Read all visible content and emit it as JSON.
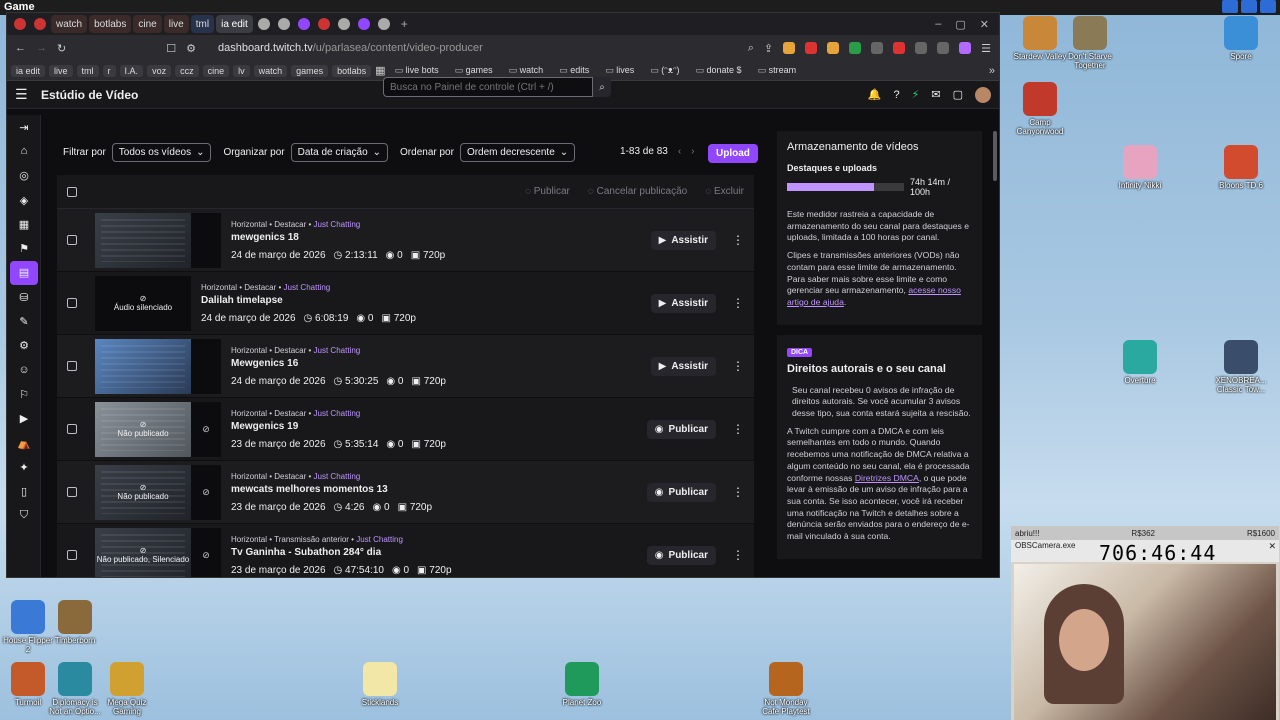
{
  "os": {
    "title": "Game"
  },
  "tabs": [
    {
      "label": "watch",
      "style": "colored"
    },
    {
      "label": "botlabs",
      "style": "colored"
    },
    {
      "label": "cine",
      "style": "colored"
    },
    {
      "label": "live",
      "style": "colored"
    },
    {
      "label": "tml",
      "style": "blue"
    },
    {
      "label": "ia edit",
      "style": "active"
    }
  ],
  "address": {
    "host": "dashboard.twitch.tv",
    "path": "/u/parlasea/content/video-producer"
  },
  "bookmarks": [
    "ia edit",
    "live",
    "tml",
    "r",
    "I.A.",
    "voz",
    "ccz",
    "cine",
    "lv",
    "watch",
    "games",
    "botlabs"
  ],
  "bookmark_folders": [
    "live bots",
    "games",
    "watch",
    "edits",
    "lives",
    "(ᵔᴥᵔ)",
    "donate $",
    "stream"
  ],
  "header": {
    "title": "Estúdio de Vídeo",
    "search_placeholder": "Busca no Painel de controle (Ctrl + /)"
  },
  "filters": {
    "filter_label": "Filtrar por",
    "filter_value": "Todos os vídeos",
    "org_label": "Organizar por",
    "org_value": "Data de criação",
    "order_label": "Ordenar por",
    "order_value": "Ordem decrescente",
    "range": "1-83 de 83",
    "upload": "Upload"
  },
  "list_actions": {
    "publish": "Publicar",
    "unpublish": "Cancelar publicação",
    "delete": "Excluir"
  },
  "videos": [
    {
      "tags": "Horizontal • Destacar • ",
      "category": "Just Chatting",
      "title": "mewgenics 18",
      "date": "24 de março de 2026",
      "duration": "2:13:11",
      "views": "0",
      "quality": "720p",
      "action": "Assistir",
      "thumb": "default",
      "thumb_text": ""
    },
    {
      "tags": "Horizontal • Destacar • ",
      "category": "Just Chatting",
      "title": "Dalilah timelapse",
      "date": "24 de março de 2026",
      "duration": "6:08:19",
      "views": "0",
      "quality": "720p",
      "action": "Assistir",
      "thumb": "dark",
      "thumb_text": "Áudio silenciado"
    },
    {
      "tags": "Horizontal • Destacar • ",
      "category": "Just Chatting",
      "title": "Mewgenics 16",
      "date": "24 de março de 2026",
      "duration": "5:30:25",
      "views": "0",
      "quality": "720p",
      "action": "Assistir",
      "thumb": "blue",
      "thumb_text": ""
    },
    {
      "tags": "Horizontal • Destacar • ",
      "category": "Just Chatting",
      "title": "Mewgenics 19",
      "date": "23 de março de 2026",
      "duration": "5:35:14",
      "views": "0",
      "quality": "720p",
      "action": "Publicar",
      "thumb": "grey",
      "thumb_text": "Não publicado"
    },
    {
      "tags": "Horizontal • Destacar • ",
      "category": "Just Chatting",
      "title": "mewcats melhores momentos 13",
      "date": "23 de março de 2026",
      "duration": "4:26",
      "views": "0",
      "quality": "720p",
      "action": "Publicar",
      "thumb": "default",
      "thumb_text": "Não publicado"
    },
    {
      "tags": "Horizontal • Transmissão anterior • ",
      "category": "Just Chatting",
      "title": "Tv Ganinha - Subathon 284° dia",
      "date": "23 de março de 2026",
      "duration": "47:54:10",
      "views": "0",
      "quality": "720p",
      "action": "Publicar",
      "thumb": "default",
      "thumb_text": "Não publicado, Silenciado"
    }
  ],
  "storage": {
    "title": "Armazenamento de vídeos",
    "subtitle": "Destaques e uploads",
    "value": "74h 14m / 100h",
    "fraction": 0.742,
    "p1": "Este medidor rastreia a capacidade de armazenamento do seu canal para destaques e uploads, limitada a 100 horas por canal.",
    "p2": "Clipes e transmissões anteriores (VODs) não contam para esse limite de armazenamento. Para saber mais sobre esse limite e como gerenciar seu armazenamento, ",
    "link": "acesse nosso artigo de ajuda"
  },
  "copyright": {
    "badge": "DICA",
    "title": "Direitos autorais e o seu canal",
    "p1": "Seu canal recebeu 0 avisos de infração de direitos autorais. Se você acumular 3 avisos desse tipo, sua conta estará sujeita a rescisão.",
    "p2": "A Twitch cumpre com a DMCA e com leis semelhantes em todo o mundo. Quando recebemos uma notificação de DMCA relativa a algum conteúdo no seu canal, ela é processada conforme nossas ",
    "link": "Diretrizes DMCA",
    "p3": ", o que pode levar à emissão de um aviso de infração para a sua conta. Se isso acontecer, você irá receber uma notificação na Twitch e detalhes sobre a denúncia serão enviados para o endereço de e-mail vinculado à sua conta."
  },
  "desktop_icons": [
    {
      "label": "Stardew Valley",
      "color": "#c9873a"
    },
    {
      "label": "Don't Starve Together",
      "color": "#8a7a55"
    },
    {
      "label": "Spore",
      "color": "#3b8fd6"
    },
    {
      "label": "Camp Canyonwood",
      "color": "#c0392b"
    },
    {
      "label": "Infinity Nikki",
      "color": "#e6a4c0"
    },
    {
      "label": "Bloons TD 6",
      "color": "#d34b2e"
    },
    {
      "label": "Overture",
      "color": "#2aa9a0"
    },
    {
      "label": "XENOBREA... Classic Tow...",
      "color": "#3a4d6a"
    },
    {
      "label": "House Flipper 2",
      "color": "#3a7ad6"
    },
    {
      "label": "Timberborn",
      "color": "#8a6a3a"
    },
    {
      "label": "Turmoil",
      "color": "#c45a2a"
    },
    {
      "label": "Diplomacy is Not an Optio...",
      "color": "#2a8aa0"
    },
    {
      "label": "Mega Quiz Gaming",
      "color": "#d0a030"
    },
    {
      "label": "Sticklands",
      "color": "#f2e7a6"
    },
    {
      "label": "Planet Zoo",
      "color": "#1f9a5a"
    },
    {
      "label": "Not Monday Cafe Playtest",
      "color": "#b5651d"
    }
  ],
  "cam": {
    "hud_left": "abriu!!!",
    "hud_mid": "R$362",
    "hud_right": "R$1600",
    "window_title": "OBSCamera.exe",
    "timer": "706:46:44"
  }
}
